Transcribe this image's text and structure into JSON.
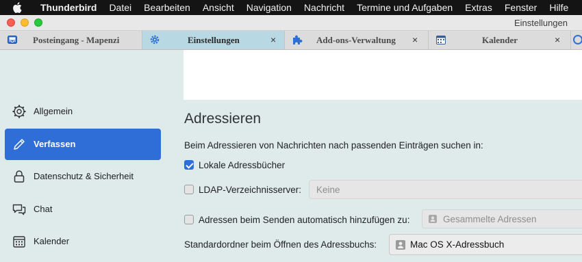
{
  "menubar": {
    "items": [
      "Thunderbird",
      "Datei",
      "Bearbeiten",
      "Ansicht",
      "Navigation",
      "Nachricht",
      "Termine und Aufgaben",
      "Extras",
      "Fenster",
      "Hilfe"
    ]
  },
  "window": {
    "title": "Einstellungen"
  },
  "tabs": [
    {
      "label": "Posteingang - Mapenzi",
      "icon": "inbox-icon"
    },
    {
      "label": "Einstellungen",
      "icon": "gear-icon",
      "close": "×"
    },
    {
      "label": "Add-ons-Verwaltung",
      "icon": "puzzle-icon",
      "close": "×"
    },
    {
      "label": "Kalender",
      "icon": "calendar-icon",
      "close": "×"
    }
  ],
  "sidebar": {
    "items": [
      {
        "label": "Allgemein",
        "icon": "gear-icon"
      },
      {
        "label": "Verfassen",
        "icon": "pencil-icon"
      },
      {
        "label": "Datenschutz & Sicherheit",
        "icon": "lock-icon"
      },
      {
        "label": "Chat",
        "icon": "chat-icon"
      },
      {
        "label": "Kalender",
        "icon": "calendar-icon"
      }
    ]
  },
  "main": {
    "heading": "Adressieren",
    "intro": "Beim Adressieren von Nachrichten nach passenden Einträgen suchen in:",
    "local_books_label": "Lokale Adressbücher",
    "local_books_checked": true,
    "ldap_label": "LDAP-Verzeichnisserver:",
    "ldap_checked": false,
    "ldap_value": "Keine",
    "auto_add_label": "Adressen beim Senden automatisch hinzufügen zu:",
    "auto_add_checked": false,
    "auto_add_value": "Gesammelte Adressen",
    "default_dir_label": "Standardordner beim Öffnen des Adressbuchs:",
    "default_dir_value": "Mac OS X-Adressbuch"
  },
  "colors": {
    "accent": "#2e6ed6",
    "active_tab": "#b8d9e3",
    "sidebar_bg": "#dfeaeb"
  }
}
